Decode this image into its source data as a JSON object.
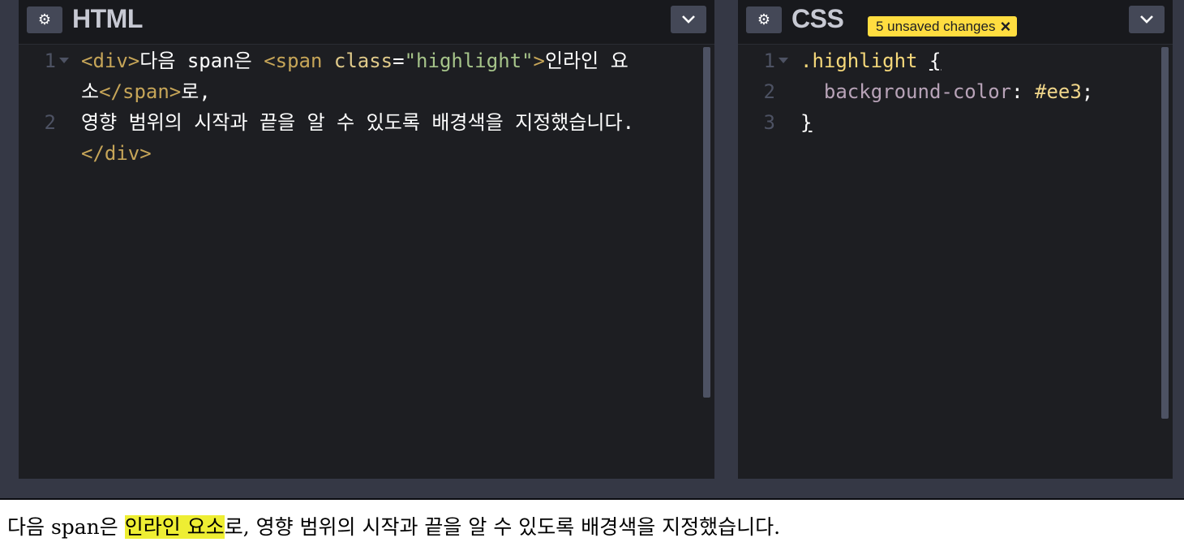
{
  "html_panel": {
    "title": "HTML",
    "lines": [
      {
        "n": "1",
        "folded": true
      },
      {
        "n": ""
      },
      {
        "n": "2"
      },
      {
        "n": ""
      }
    ],
    "code": {
      "l1_open_tag": "<div>",
      "l1_text": "다음 span은 ",
      "l1_span_open": "<span",
      "l1_attr": " class",
      "l1_eq": "=",
      "l1_str": "\"highlight\"",
      "l1_close": ">",
      "l1_inline": "인라인 요",
      "l1b_text": "소",
      "l1b_span_close": "</span>",
      "l1b_rest": "로,",
      "l2_text": "영향 범위의 시작과 끝을 알 수 있도록 배경색을 지정했습니다.",
      "l2b_close": "</div>"
    }
  },
  "css_panel": {
    "title": "CSS",
    "badge": "5 unsaved changes",
    "lines": [
      {
        "n": "1",
        "folded": true
      },
      {
        "n": "2"
      },
      {
        "n": "3"
      }
    ],
    "code": {
      "l1_selector": ".highlight",
      "l1_brace": "{",
      "l2_prop": "background-color",
      "l2_colon": ": ",
      "l2_value": "#ee3",
      "l2_semi": ";",
      "l3_brace": "}"
    }
  },
  "preview": {
    "before": "다음 span은 ",
    "highlight": "인라인 요소",
    "after": "로, 영향 범위의 시작과 끝을 알 수 있도록 배경색을 지정했습니다."
  },
  "colors": {
    "highlight": "#eeee33",
    "badge": "#ffdd40",
    "editor_bg": "#1d1e22",
    "chrome_bg": "#353845"
  }
}
